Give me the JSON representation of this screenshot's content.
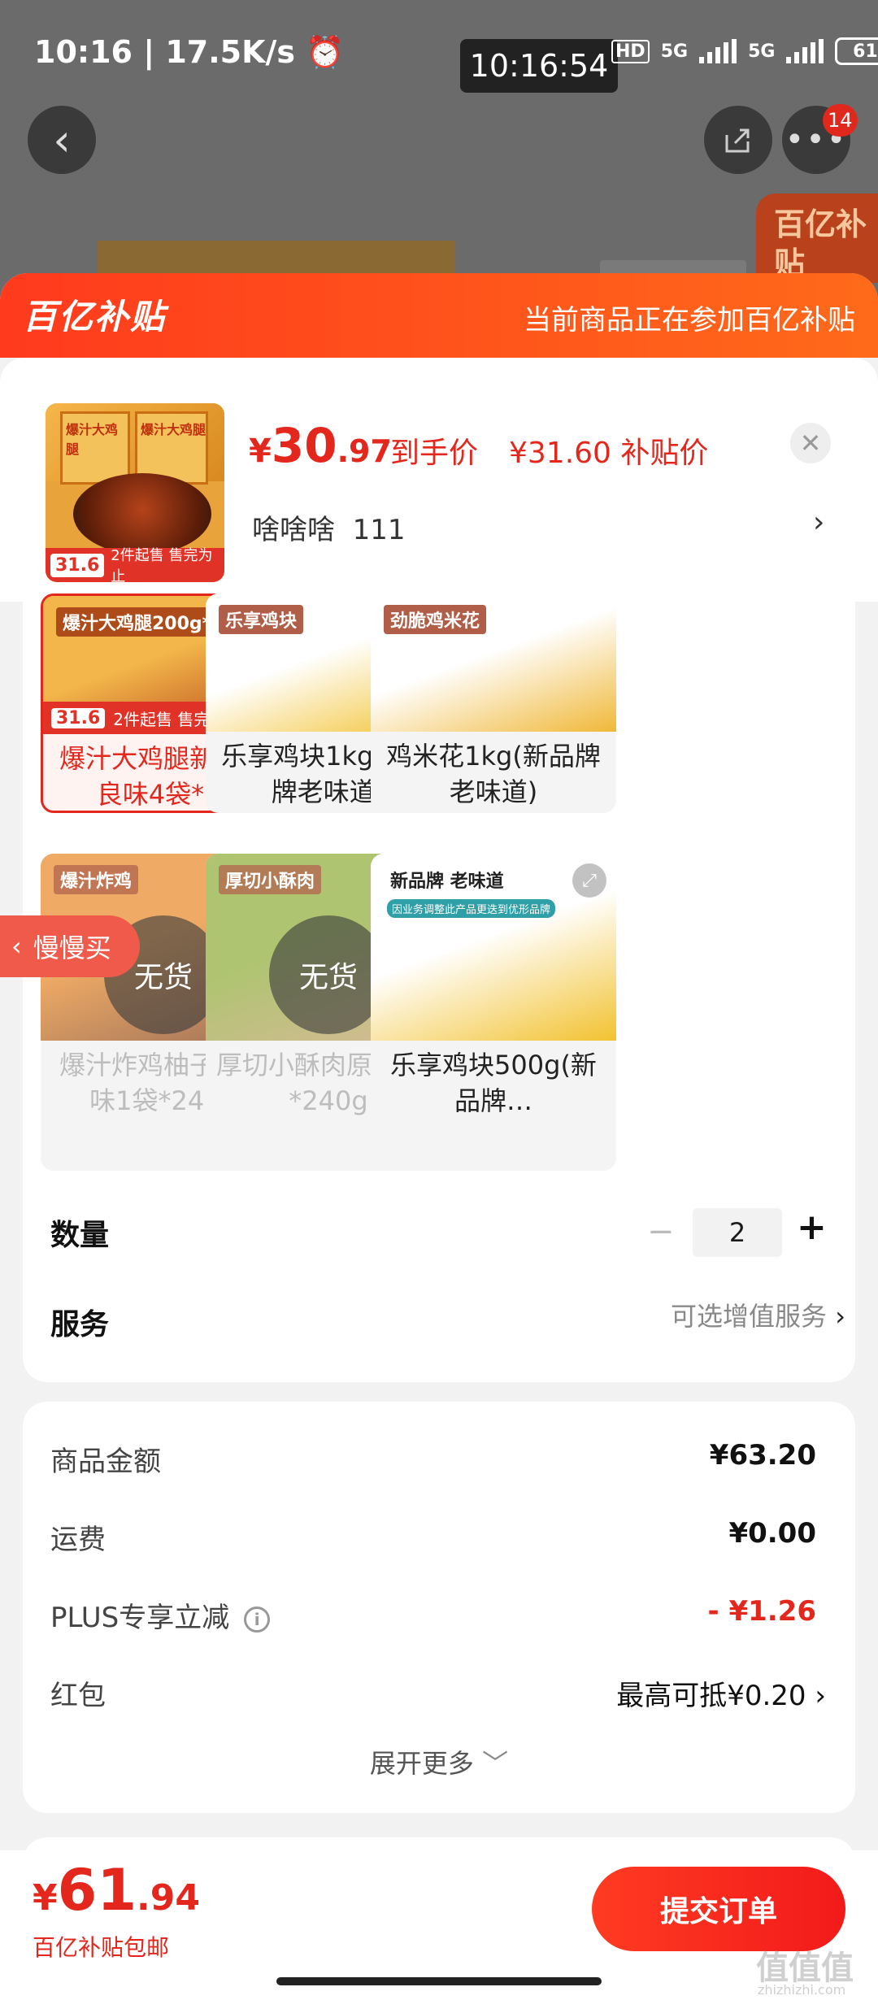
{
  "status_bar": {
    "time": "10:16",
    "speed": "17.5K/s",
    "alarm_icon": "alarm-icon",
    "clock_overlay": "10:16:54",
    "hd": "HD",
    "net1": "5G",
    "net2": "5G",
    "battery": "61"
  },
  "background_page": {
    "back_icon": "chevron-left-icon",
    "share_icon": "share-icon",
    "more_icon": "more-dots-icon",
    "badge": "14",
    "logo": "百亿补贴"
  },
  "banner": {
    "logo_text": "百亿补贴",
    "note": "当前商品正在参加百亿补贴"
  },
  "product": {
    "thumb_price": "31.6",
    "thumb_label": "2件起售 售完为止",
    "thumb_bag_text": "爆汁大鸡腿",
    "price_yen": "¥",
    "price_int": "30",
    "price_dec": ".97",
    "price_label": "到手价",
    "subsidy_price": "¥31.60 补贴价",
    "spec": "啥啥啥  111",
    "close_icon": "close-icon"
  },
  "variants": [
    {
      "name": "爆汁大鸡腿新奥尔良味4袋*…",
      "selected": true,
      "out_of_stock": false,
      "tag": "爆汁大鸡腿200g*4",
      "price": "31.6",
      "sale": "2件起售 售完为止"
    },
    {
      "name": "乐享鸡块1kg(新品牌老味道)",
      "selected": false,
      "out_of_stock": false,
      "tag": "乐享鸡块"
    },
    {
      "name": "鸡米花1kg(新品牌老味道)",
      "selected": false,
      "out_of_stock": false,
      "tag": "劲脆鸡米花"
    },
    {
      "name": "爆汁炸鸡柚子胡椒味1袋*240g",
      "selected": false,
      "out_of_stock": true,
      "tag": "爆汁炸鸡",
      "oos_text": "无货"
    },
    {
      "name": "厚切小酥肉原味4袋*240g",
      "selected": false,
      "out_of_stock": true,
      "tag": "厚切小酥肉",
      "oos_text": "无货"
    },
    {
      "name": "乐享鸡块500g(新品牌…",
      "selected": false,
      "out_of_stock": false,
      "tag": "新品牌 老味道",
      "sub": "因业务调整此产品更迭到优形品牌"
    }
  ],
  "slow_buy": "慢慢买",
  "quantity": {
    "label": "数量",
    "value": "2",
    "minus": "−",
    "plus": "+"
  },
  "service": {
    "label": "服务",
    "value": "可选增值服务"
  },
  "price_detail": {
    "goods_label": "商品金额",
    "goods_value": "¥63.20",
    "shipping_label": "运费",
    "shipping_value": "¥0.00",
    "plus_label": "PLUS专享立减",
    "plus_value": "- ¥1.26",
    "redpack_label": "红包",
    "redpack_value": "最高可抵¥0.20",
    "more": "展开更多"
  },
  "footer": {
    "yen": "¥",
    "int": "61",
    "dec": ".94",
    "note": "百亿补贴包邮",
    "submit": "提交订单"
  },
  "watermark": {
    "logo": "值值值",
    "url": "zhizhizhi.com"
  },
  "colors": {
    "accent": "#e4271c",
    "banner_start": "#ff3a1d",
    "banner_end": "#ff6a1a"
  }
}
